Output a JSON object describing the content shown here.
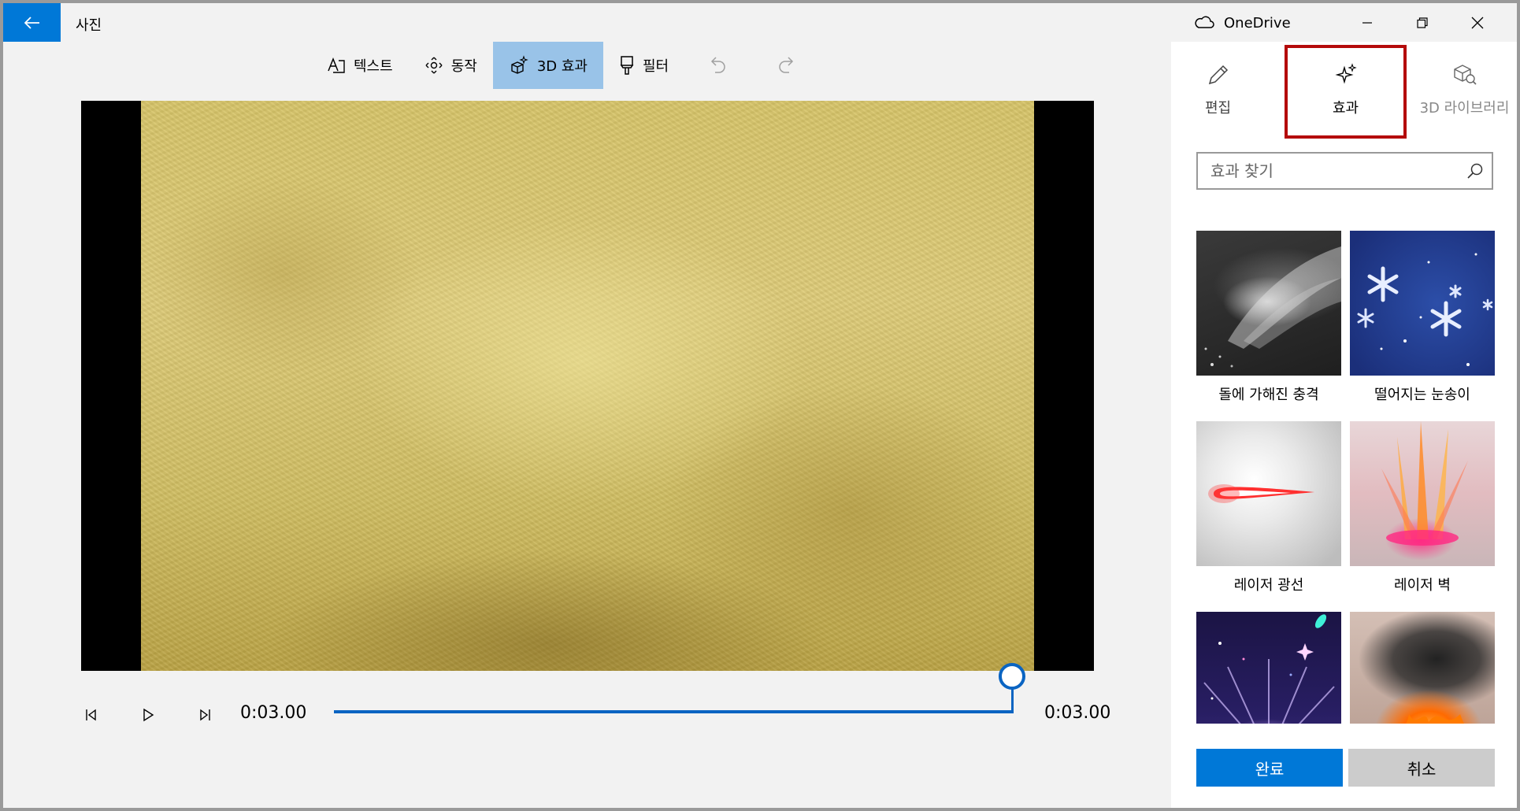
{
  "app": {
    "title": "사진"
  },
  "toolbar": {
    "text": "텍스트",
    "motion": "동작",
    "effects3d": "3D 효과",
    "filter": "필터"
  },
  "playback": {
    "current_time": "0:03.00",
    "end_time": "0:03.00",
    "progress": 1.0
  },
  "titlebar": {
    "onedrive": "OneDrive"
  },
  "panel": {
    "tabs": [
      {
        "label": "편집",
        "icon": "pencil-icon"
      },
      {
        "label": "효과",
        "icon": "sparkle-icon",
        "active": true
      },
      {
        "label": "3D 라이브러리",
        "icon": "cube-search-icon"
      }
    ],
    "search_placeholder": "효과 찾기",
    "effects": [
      {
        "label": "돌에 가해진 충격"
      },
      {
        "label": "떨어지는 눈송이"
      },
      {
        "label": "레이저 광선"
      },
      {
        "label": "레이저 벽"
      },
      {
        "label": ""
      },
      {
        "label": ""
      }
    ],
    "done": "완료",
    "cancel": "취소"
  },
  "colors": {
    "accent": "#0078d7",
    "active_tool": "#99c3e8",
    "highlight_box": "#b40a0a"
  }
}
